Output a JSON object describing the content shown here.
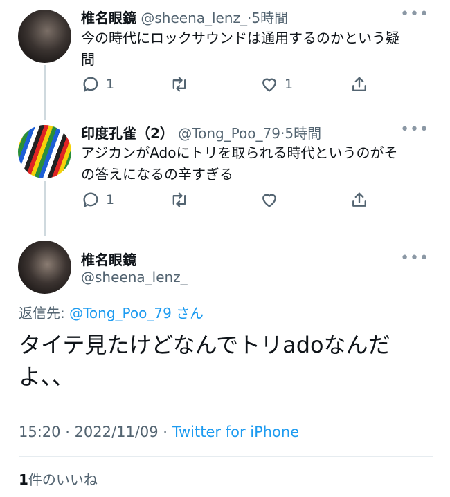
{
  "tweets": [
    {
      "name": "椎名眼鏡",
      "handle": "@sheena_lenz_",
      "sep": "·",
      "time": "5時間",
      "text_line1": "今の時代にロックサウンドは通用するのかという疑",
      "text_line2": "問",
      "reply_count": "1",
      "like_count": "1"
    },
    {
      "name": "印度孔雀（2）",
      "handle": "@Tong_Poo_79",
      "sep": "·",
      "time": "5時間",
      "text_line1": "アジカンがAdoにトリを取られる時代というのがそ",
      "text_line2": "の答えになるの辛すぎる",
      "reply_count": "1",
      "like_count": ""
    }
  ],
  "main_tweet": {
    "name": "椎名眼鏡",
    "handle": "@sheena_lenz_",
    "reply_prefix": "返信先: ",
    "reply_to": "@Tong_Poo_79",
    "reply_suffix": " さん",
    "text_line1": "タイテ見たけどなんでトリadoなんだ",
    "text_line2": "よ、、",
    "time": "15:20",
    "date": "2022/11/09",
    "dot": " · ",
    "source": "Twitter for iPhone",
    "likes_count": "1",
    "likes_label": "件のいいね"
  },
  "icons": [
    "more-icon",
    "reply-icon",
    "retweet-icon",
    "like-icon",
    "share-icon"
  ],
  "colors": {
    "link": "#1d9bf0",
    "secondary": "#536471",
    "text": "#0f1419"
  }
}
